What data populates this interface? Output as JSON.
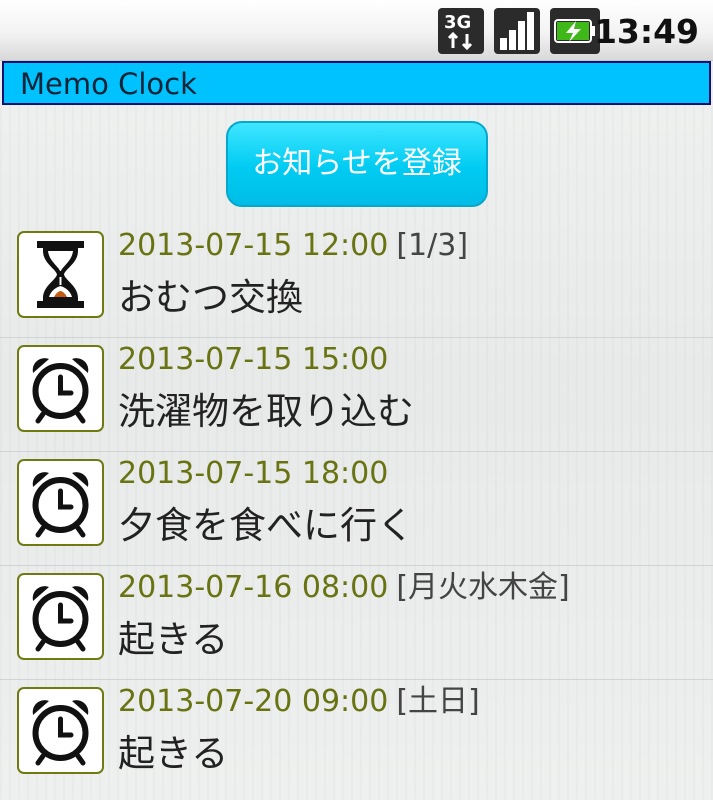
{
  "status_bar": {
    "network": "3G",
    "time": "13:49"
  },
  "app": {
    "title": "Memo Clock"
  },
  "register_button": {
    "label": "お知らせを登録"
  },
  "items": [
    {
      "datetime": "2013-07-15 12:00",
      "repeat": "[1/3]",
      "title": "おむつ交換",
      "icon": "hourglass-icon"
    },
    {
      "datetime": "2013-07-15 15:00",
      "repeat": "",
      "title": "洗濯物を取り込む",
      "icon": "alarm-clock-icon"
    },
    {
      "datetime": "2013-07-15 18:00",
      "repeat": "",
      "title": "夕食を食べに行く",
      "icon": "alarm-clock-icon"
    },
    {
      "datetime": "2013-07-16 08:00",
      "repeat": "[月火水木金]",
      "title": "起きる",
      "icon": "alarm-clock-icon"
    },
    {
      "datetime": "2013-07-20 09:00",
      "repeat": "[土日]",
      "title": "起きる",
      "icon": "alarm-clock-icon"
    }
  ],
  "colors": {
    "title_bar": "#00c2ff",
    "button": "#00cbf2",
    "datetime_text": "#6a7312",
    "icon_border": "#6f7a12"
  }
}
